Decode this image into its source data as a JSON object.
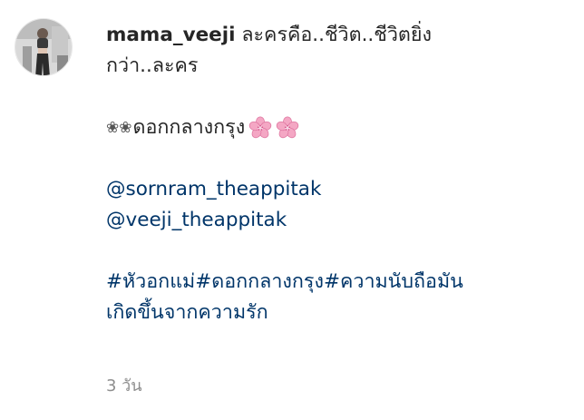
{
  "comment": {
    "username": "mama_veeji",
    "caption_line1": " ละครคือ..ชีวิต..ชีวิตยิ่ง",
    "caption_line2": "กว่า..ละคร",
    "outline_flowers": "❀❀",
    "title_text": "ดอกกลางกรุง",
    "mentions": [
      "@sornram_theappitak",
      "@veeji_theappitak"
    ],
    "hashtags": [
      "#หัวอกแม่",
      "#ดอกกลางกรุง",
      "#ความนับถือมัน"
    ],
    "hashtag_continuation": "เกิดขึ้นจากความรัก",
    "timestamp": "3 วัน"
  },
  "icons": {
    "avatar": "profile-photo",
    "blossom": "cherry-blossom-emoji"
  },
  "colors": {
    "text": "#262626",
    "link": "#003569",
    "muted": "#8e8e8e",
    "blossom": "#f4a7c4"
  }
}
